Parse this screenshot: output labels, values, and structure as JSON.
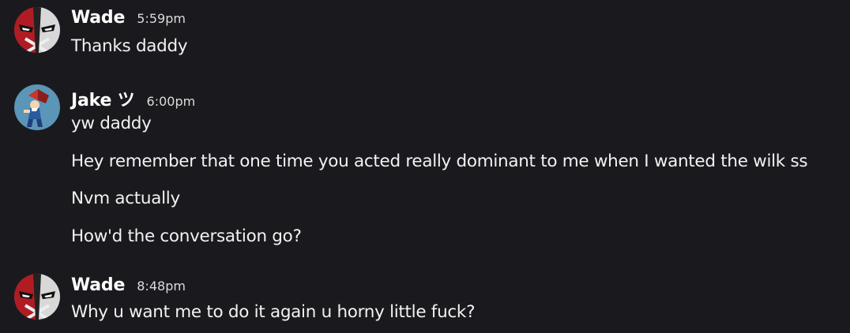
{
  "groups": [
    {
      "author": "Wade",
      "time": "5:59pm",
      "avatar_icon": "masked-antihero-avatar-icon",
      "messages": [
        "Thanks daddy"
      ]
    },
    {
      "author": "Jake ツ",
      "time": "6:00pm",
      "avatar_icon": "cartoon-character-avatar-icon",
      "messages": [
        "yw daddy",
        "Hey remember that one time you acted really dominant to me when I wanted the wilk ss",
        "Nvm actually",
        "How'd the conversation go?"
      ]
    },
    {
      "author": "Wade",
      "time": "8:48pm",
      "avatar_icon": "masked-antihero-avatar-icon",
      "messages": [
        "Why u want me to do it again u horny little fuck?"
      ]
    }
  ],
  "colors": {
    "background": "#1a1a1e",
    "username": "#ffffff",
    "timestamp": "#dcdcdc",
    "message_text": "#f2f2f2"
  }
}
